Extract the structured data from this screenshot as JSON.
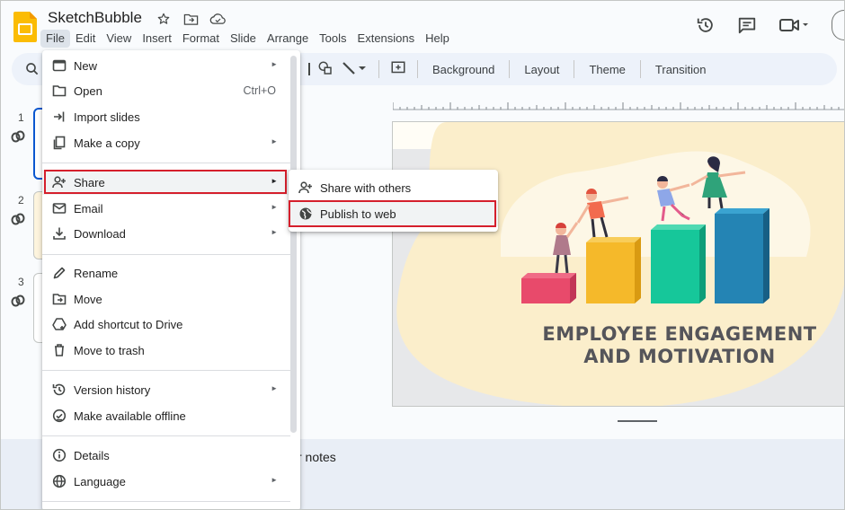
{
  "header": {
    "doc_title": "SketchBubble",
    "menus": [
      "File",
      "Edit",
      "View",
      "Insert",
      "Format",
      "Slide",
      "Arrange",
      "Tools",
      "Extensions",
      "Help"
    ],
    "active_menu": "File"
  },
  "toolbar": {
    "buttons": [
      "Background",
      "Layout",
      "Theme",
      "Transition"
    ]
  },
  "filmstrip": {
    "slide_numbers": [
      "1",
      "2",
      "3"
    ]
  },
  "file_menu": {
    "new": "New",
    "open": "Open",
    "open_shortcut": "Ctrl+O",
    "import_slides": "Import slides",
    "make_copy": "Make a copy",
    "share": "Share",
    "email": "Email",
    "download": "Download",
    "rename": "Rename",
    "move": "Move",
    "add_shortcut": "Add shortcut to Drive",
    "move_to_trash": "Move to trash",
    "version_history": "Version history",
    "make_offline": "Make available offline",
    "details": "Details",
    "language": "Language",
    "submenu_arrow": "►"
  },
  "share_submenu": {
    "share_with_others": "Share with others",
    "publish_to_web": "Publish to web"
  },
  "slide": {
    "title_line1": "EMPLOYEE ENGAGEMENT",
    "title_line2": "AND MOTIVATION"
  },
  "notes": {
    "placeholder_visible": "r notes"
  },
  "colors": {
    "highlight_box": "#d51f2c",
    "accent": "#0b57d0",
    "bar_colors": [
      "#e84a6b",
      "#f5b92a",
      "#16c79a",
      "#2484b4"
    ],
    "blob": "#fbeecb"
  },
  "icons": [
    "star-icon",
    "move-to-folder-icon",
    "cloud-saved-icon",
    "history-icon",
    "comment-icon",
    "video-call-icon",
    "search-icon",
    "link-icon",
    "grid-view-icon"
  ]
}
